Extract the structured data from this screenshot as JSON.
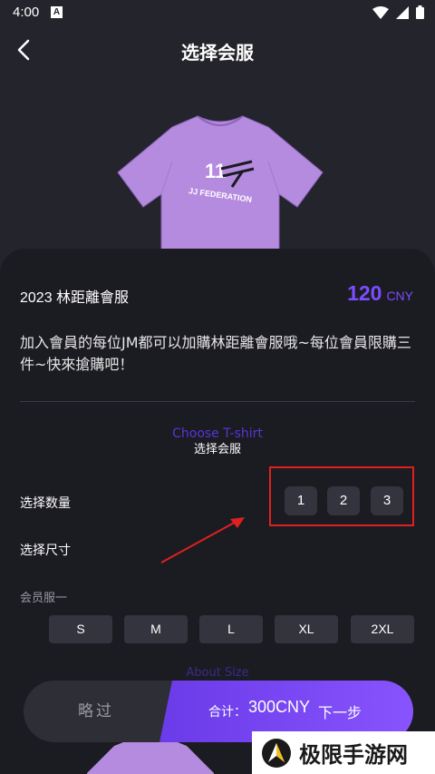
{
  "status": {
    "time": "4:00",
    "app_icon": "A"
  },
  "header": {
    "title": "选择会服"
  },
  "product": {
    "name": "2023 林距離會服",
    "price": "120",
    "currency": "CNY",
    "description": "加入會員的每位JM都可以加購林距離會服哦~每位會員限購三件~快來搶購吧！",
    "shirt_print": [
      "11",
      "JJ FEDERATION"
    ]
  },
  "section": {
    "title_en": "Choose T-shirt",
    "title_cn": "选择会服"
  },
  "quantity": {
    "label": "选择数量",
    "options": [
      "1",
      "2",
      "3"
    ]
  },
  "size": {
    "label": "选择尺寸",
    "group_label": "会员服一",
    "options": [
      "S",
      "M",
      "L",
      "XL",
      "2XL"
    ],
    "about_label": "About Size"
  },
  "bottom": {
    "skip_label": "略过",
    "total_label": "合计：",
    "total_amount": "300CNY",
    "next_label": "下一步"
  },
  "watermark": {
    "text": "极限手游网"
  },
  "colors": {
    "accent": "#7c4dff",
    "shirt": "#b58be0",
    "highlight": "#e02020",
    "background": "#24242c"
  }
}
